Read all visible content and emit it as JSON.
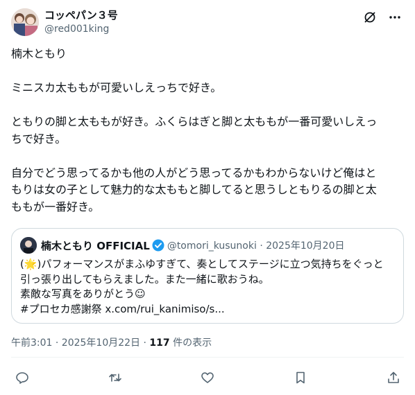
{
  "author": {
    "display_name": "コッペパン３号",
    "handle": "@red001king",
    "avatar_icon": "anime-avatar-image"
  },
  "header_icons": [
    "grok-icon",
    "more-icon"
  ],
  "post": {
    "text": "楠木ともり\n\nミニスカ太ももが可愛いしえっちで好き。\n\nともりの脚と太ももが好き。ふくらはぎと脚と太ももが一番可愛いしえっ\nちで好き。\n\n自分でどう思ってるかも他の人がどう思ってるかもわからないけど俺はと\nもりは女の子として魅力的な太ももと脚してると思うしともりるの脚と太\nももが一番好き。"
  },
  "quoted_post": {
    "display_name": "楠木ともり OFFICIAL",
    "verified_color": "#1d9bf0",
    "meta": "@tomori_kusunoki · 2025年10月20日",
    "text": "(🌟)パフォーマンスがまふゆすぎて、奏としてステージに立つ気持ちをぐっと\n引っ張り出してもらえました。また一緒に歌おうね。\n素敵な写真をありがとう☺\n#プロセカ感謝祭 x.com/rui_kanimiso/s..."
  },
  "timestamp": {
    "time_date": "午前3:01 · 2025年10月22日 · ",
    "views_count": "117",
    "views_label": " 件の表示"
  },
  "actions": [
    "reply-icon",
    "repost-icon",
    "like-icon",
    "bookmark-icon",
    "share-icon"
  ],
  "colors": {
    "secondary_text": "#536471",
    "border": "#cfd9de",
    "icon": "#536471"
  }
}
